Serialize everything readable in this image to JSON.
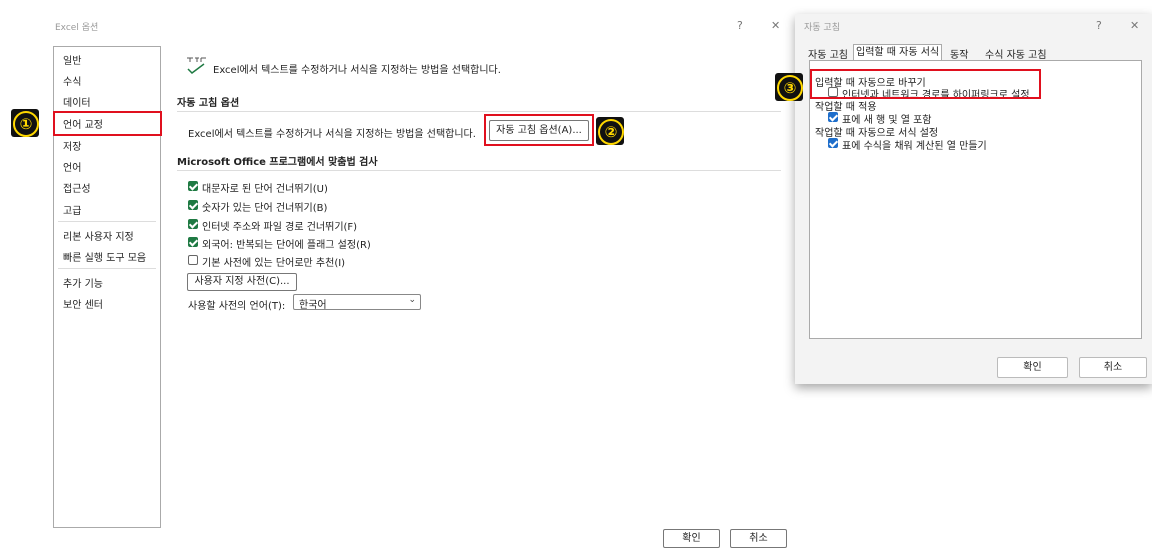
{
  "options_dialog": {
    "title": "Excel 옵션",
    "help": "?",
    "close": "✕",
    "nav_items": [
      {
        "label": "일반"
      },
      {
        "label": "수식"
      },
      {
        "label": "데이터"
      },
      {
        "label": "언어 교정"
      },
      {
        "label": "저장"
      },
      {
        "label": "언어"
      },
      {
        "label": "접근성"
      },
      {
        "label": "고급"
      },
      {
        "label": "리본 사용자 지정"
      },
      {
        "label": "빠른 실행 도구 모음"
      },
      {
        "label": "추가 기능"
      },
      {
        "label": "보안 센터"
      }
    ],
    "header_text": "Excel에서 텍스트를 수정하거나 서식을 지정하는 방법을 선택합니다.",
    "autocorrect_section": {
      "title": "자동 고침 옵션",
      "description": "Excel에서 텍스트를 수정하거나 서식을 지정하는 방법을 선택합니다.",
      "button": "자동 고침 옵션(A)..."
    },
    "spell_section": {
      "title": "Microsoft Office 프로그램에서 맞춤법 검사",
      "options": [
        {
          "label": "대문자로 된 단어 건너뛰기(U)",
          "checked": true
        },
        {
          "label": "숫자가 있는 단어 건너뛰기(B)",
          "checked": true
        },
        {
          "label": "인터넷 주소와 파일 경로 건너뛰기(F)",
          "checked": true
        },
        {
          "label": "외국어: 반복되는 단어에 플래그 설정(R)",
          "checked": true
        },
        {
          "label": "기본 사전에 있는 단어로만 추천(I)",
          "checked": false
        }
      ],
      "custom_dict_button": "사용자 지정 사전(C)...",
      "dict_lang_label": "사용할 사전의 언어(T):",
      "dict_lang_value": "한국어"
    },
    "ok": "확인",
    "cancel": "취소"
  },
  "autocorrect_dialog": {
    "title": "자동 고침",
    "help": "?",
    "close": "✕",
    "tabs": [
      "자동 고침",
      "입력할 때 자동 서식",
      "동작",
      "수식 자동 고침"
    ],
    "active_tab": "입력할 때 자동 서식",
    "group1": {
      "title": "입력할 때 자동으로 바꾸기",
      "option": "인터넷과 네트워크 경로를 하이퍼링크로 설정",
      "checked": false
    },
    "group2": {
      "title": "작업할 때 적용",
      "option": "표에 새 행 및 열 포함",
      "checked": true
    },
    "group3": {
      "title": "작업할 때 자동으로 서식 설정",
      "option": "표에 수식을 채워 계산된 열 만들기",
      "checked": true
    },
    "ok": "확인",
    "cancel": "취소"
  },
  "annotations": {
    "step1": "①",
    "step2": "②",
    "step3": "③",
    "highlight_color": "#e0101e",
    "badge_color": "#ffd800"
  }
}
